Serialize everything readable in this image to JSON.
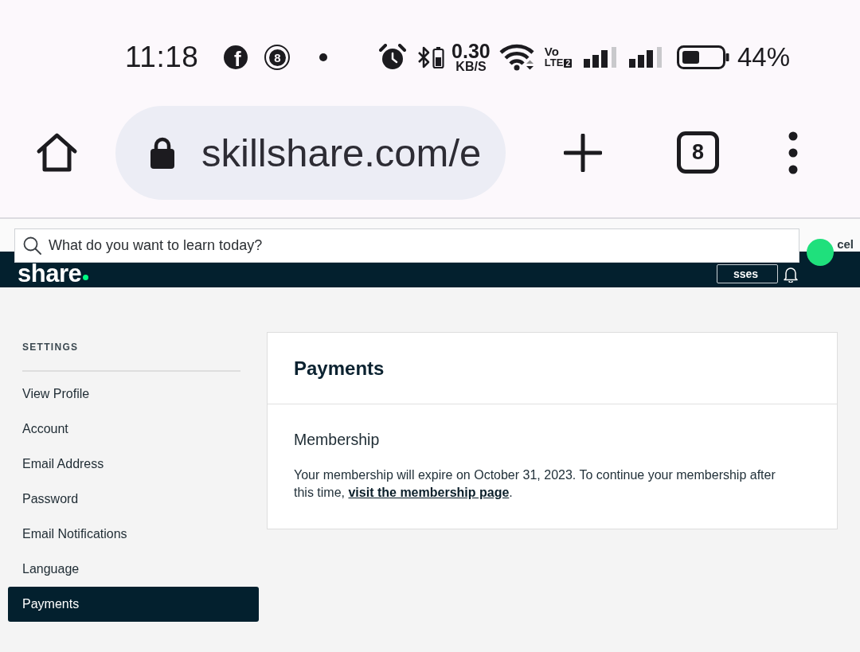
{
  "status_bar": {
    "time": "11:18",
    "notifications": [
      {
        "kind": "logo",
        "glyph": "f"
      },
      {
        "kind": "badge",
        "glyph": "8"
      },
      {
        "kind": "dot"
      }
    ],
    "network_speed": "0.30",
    "network_speed_unit": "KB/S",
    "volte": {
      "top": "Vo",
      "bottom": "LTE",
      "sim": "2"
    },
    "battery_percent": "44%"
  },
  "browser_toolbar": {
    "url": "skillshare.com/e",
    "tab_count": "8"
  },
  "header": {
    "logo": "share",
    "search": {
      "placeholder": "What do you want to learn today?"
    },
    "button": "sses",
    "link": "cel"
  },
  "sidebar": {
    "heading": "SETTINGS",
    "items": [
      {
        "label": "View Profile",
        "selected": false
      },
      {
        "label": "Account",
        "selected": false
      },
      {
        "label": "Email Address",
        "selected": false
      },
      {
        "label": "Password",
        "selected": false
      },
      {
        "label": "Email Notifications",
        "selected": false
      },
      {
        "label": "Language",
        "selected": false
      },
      {
        "label": "Payments",
        "selected": true
      }
    ]
  },
  "panel": {
    "title": "Payments",
    "section_title": "Membership",
    "text": "Your membership will expire on October 31, 2023. To continue your membership after this time, ",
    "link": "visit the membership page",
    "text_end": "."
  }
}
